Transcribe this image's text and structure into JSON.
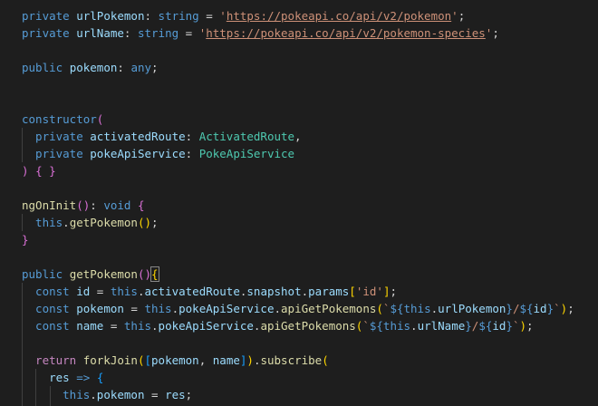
{
  "editor": {
    "language": "typescript",
    "theme": {
      "background": "#1e1e1e",
      "keyword": "#569cd6",
      "control": "#c586c0",
      "variable": "#9cdcfe",
      "function": "#dcdcaa",
      "type": "#4ec9b0",
      "string": "#ce9178",
      "plain": "#d4d4d4",
      "bracket_level_1": "#da70d6",
      "bracket_level_2": "#ffd700",
      "bracket_level_3": "#179fff"
    },
    "lines": [
      [
        {
          "t": "private ",
          "c": "kw"
        },
        {
          "t": "urlPokemon",
          "c": "var"
        },
        {
          "t": ": ",
          "c": "plain"
        },
        {
          "t": "string",
          "c": "kw"
        },
        {
          "t": " = ",
          "c": "plain"
        },
        {
          "t": "'",
          "c": "str"
        },
        {
          "t": "https://pokeapi.co/api/v2/pokemon",
          "c": "url"
        },
        {
          "t": "'",
          "c": "str"
        },
        {
          "t": ";",
          "c": "plain"
        }
      ],
      [
        {
          "t": "private ",
          "c": "kw"
        },
        {
          "t": "urlName",
          "c": "var"
        },
        {
          "t": ": ",
          "c": "plain"
        },
        {
          "t": "string",
          "c": "kw"
        },
        {
          "t": " = ",
          "c": "plain"
        },
        {
          "t": "'",
          "c": "str"
        },
        {
          "t": "https://pokeapi.co/api/v2/pokemon-species",
          "c": "url"
        },
        {
          "t": "'",
          "c": "str"
        },
        {
          "t": ";",
          "c": "plain"
        }
      ],
      [],
      [
        {
          "t": "public ",
          "c": "kw"
        },
        {
          "t": "pokemon",
          "c": "var"
        },
        {
          "t": ": ",
          "c": "plain"
        },
        {
          "t": "any",
          "c": "kw"
        },
        {
          "t": ";",
          "c": "plain"
        }
      ],
      [],
      [],
      [
        {
          "t": "constructor",
          "c": "kw"
        },
        {
          "t": "(",
          "c": "b1"
        }
      ],
      [
        {
          "t": "  private ",
          "c": "kw"
        },
        {
          "t": "activatedRoute",
          "c": "var"
        },
        {
          "t": ": ",
          "c": "plain"
        },
        {
          "t": "ActivatedRoute",
          "c": "type"
        },
        {
          "t": ",",
          "c": "plain"
        }
      ],
      [
        {
          "t": "  private ",
          "c": "kw"
        },
        {
          "t": "pokeApiService",
          "c": "var"
        },
        {
          "t": ": ",
          "c": "plain"
        },
        {
          "t": "PokeApiService",
          "c": "type"
        }
      ],
      [
        {
          "t": ")",
          "c": "b1"
        },
        {
          "t": " ",
          "c": "plain"
        },
        {
          "t": "{",
          "c": "b1"
        },
        {
          "t": " ",
          "c": "plain"
        },
        {
          "t": "}",
          "c": "b1"
        }
      ],
      [],
      [
        {
          "t": "ngOnInit",
          "c": "fn"
        },
        {
          "t": "()",
          "c": "b1"
        },
        {
          "t": ": ",
          "c": "plain"
        },
        {
          "t": "void",
          "c": "kw"
        },
        {
          "t": " ",
          "c": "plain"
        },
        {
          "t": "{",
          "c": "b1"
        }
      ],
      [
        {
          "t": "  this",
          "c": "kw"
        },
        {
          "t": ".",
          "c": "plain"
        },
        {
          "t": "getPokemon",
          "c": "fn"
        },
        {
          "t": "()",
          "c": "b2"
        },
        {
          "t": ";",
          "c": "plain"
        }
      ],
      [
        {
          "t": "}",
          "c": "b1"
        }
      ],
      [],
      [
        {
          "t": "public ",
          "c": "kw"
        },
        {
          "t": "getPokemon",
          "c": "fn"
        },
        {
          "t": "()",
          "c": "b1"
        },
        {
          "t": "{",
          "c": "match"
        }
      ],
      [
        {
          "t": "  const ",
          "c": "kw"
        },
        {
          "t": "id",
          "c": "var"
        },
        {
          "t": " = ",
          "c": "plain"
        },
        {
          "t": "this",
          "c": "kw"
        },
        {
          "t": ".",
          "c": "plain"
        },
        {
          "t": "activatedRoute",
          "c": "var"
        },
        {
          "t": ".",
          "c": "plain"
        },
        {
          "t": "snapshot",
          "c": "var"
        },
        {
          "t": ".",
          "c": "plain"
        },
        {
          "t": "params",
          "c": "var"
        },
        {
          "t": "[",
          "c": "b2"
        },
        {
          "t": "'id'",
          "c": "str"
        },
        {
          "t": "]",
          "c": "b2"
        },
        {
          "t": ";",
          "c": "plain"
        }
      ],
      [
        {
          "t": "  const ",
          "c": "kw"
        },
        {
          "t": "pokemon",
          "c": "var"
        },
        {
          "t": " = ",
          "c": "plain"
        },
        {
          "t": "this",
          "c": "kw"
        },
        {
          "t": ".",
          "c": "plain"
        },
        {
          "t": "pokeApiService",
          "c": "var"
        },
        {
          "t": ".",
          "c": "plain"
        },
        {
          "t": "apiGetPokemons",
          "c": "fn"
        },
        {
          "t": "(",
          "c": "b2"
        },
        {
          "t": "`",
          "c": "str"
        },
        {
          "t": "${",
          "c": "kw"
        },
        {
          "t": "this",
          "c": "kw"
        },
        {
          "t": ".",
          "c": "plain"
        },
        {
          "t": "urlPokemon",
          "c": "var"
        },
        {
          "t": "}",
          "c": "kw"
        },
        {
          "t": "/",
          "c": "str"
        },
        {
          "t": "${",
          "c": "kw"
        },
        {
          "t": "id",
          "c": "var"
        },
        {
          "t": "}",
          "c": "kw"
        },
        {
          "t": "`",
          "c": "str"
        },
        {
          "t": ")",
          "c": "b2"
        },
        {
          "t": ";",
          "c": "plain"
        }
      ],
      [
        {
          "t": "  const ",
          "c": "kw"
        },
        {
          "t": "name",
          "c": "var"
        },
        {
          "t": " = ",
          "c": "plain"
        },
        {
          "t": "this",
          "c": "kw"
        },
        {
          "t": ".",
          "c": "plain"
        },
        {
          "t": "pokeApiService",
          "c": "var"
        },
        {
          "t": ".",
          "c": "plain"
        },
        {
          "t": "apiGetPokemons",
          "c": "fn"
        },
        {
          "t": "(",
          "c": "b2"
        },
        {
          "t": "`",
          "c": "str"
        },
        {
          "t": "${",
          "c": "kw"
        },
        {
          "t": "this",
          "c": "kw"
        },
        {
          "t": ".",
          "c": "plain"
        },
        {
          "t": "urlName",
          "c": "var"
        },
        {
          "t": "}",
          "c": "kw"
        },
        {
          "t": "/",
          "c": "str"
        },
        {
          "t": "${",
          "c": "kw"
        },
        {
          "t": "id",
          "c": "var"
        },
        {
          "t": "}",
          "c": "kw"
        },
        {
          "t": "`",
          "c": "str"
        },
        {
          "t": ")",
          "c": "b2"
        },
        {
          "t": ";",
          "c": "plain"
        }
      ],
      [],
      [
        {
          "t": "  return ",
          "c": "ctl"
        },
        {
          "t": "forkJoin",
          "c": "fn"
        },
        {
          "t": "(",
          "c": "b2"
        },
        {
          "t": "[",
          "c": "b3"
        },
        {
          "t": "pokemon",
          "c": "var"
        },
        {
          "t": ", ",
          "c": "plain"
        },
        {
          "t": "name",
          "c": "var"
        },
        {
          "t": "]",
          "c": "b3"
        },
        {
          "t": ")",
          "c": "b2"
        },
        {
          "t": ".",
          "c": "plain"
        },
        {
          "t": "subscribe",
          "c": "fn"
        },
        {
          "t": "(",
          "c": "b2"
        }
      ],
      [
        {
          "t": "    res",
          "c": "var"
        },
        {
          "t": " ",
          "c": "plain"
        },
        {
          "t": "=>",
          "c": "kw"
        },
        {
          "t": " ",
          "c": "plain"
        },
        {
          "t": "{",
          "c": "b3"
        }
      ],
      [
        {
          "t": "      this",
          "c": "kw"
        },
        {
          "t": ".",
          "c": "plain"
        },
        {
          "t": "pokemon",
          "c": "var"
        },
        {
          "t": " = ",
          "c": "plain"
        },
        {
          "t": "res",
          "c": "var"
        },
        {
          "t": ";",
          "c": "plain"
        }
      ]
    ]
  }
}
